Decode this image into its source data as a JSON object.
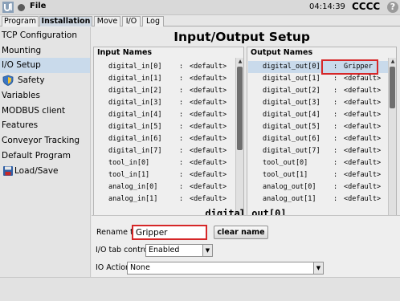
{
  "topbar": {
    "file": "File",
    "clock": "04:14:39",
    "robot": "CCCC",
    "help": "?"
  },
  "tabs": [
    {
      "label": "Program"
    },
    {
      "label": "Installation"
    },
    {
      "label": "Move"
    },
    {
      "label": "I/O"
    },
    {
      "label": "Log"
    }
  ],
  "sidebar": {
    "items": [
      {
        "label": "TCP Configuration"
      },
      {
        "label": "Mounting"
      },
      {
        "label": "I/O Setup"
      },
      {
        "label": "Safety"
      },
      {
        "label": "Variables"
      },
      {
        "label": "MODBUS client"
      },
      {
        "label": "Features"
      },
      {
        "label": "Conveyor Tracking"
      },
      {
        "label": "Default Program"
      },
      {
        "label": "Load/Save"
      }
    ]
  },
  "page": {
    "title": "Input/Output Setup"
  },
  "inputs": {
    "header": "Input Names",
    "rows": [
      {
        "name": "digital_in[0]",
        "sep": ":",
        "value": "<default>"
      },
      {
        "name": "digital_in[1]",
        "sep": ":",
        "value": "<default>"
      },
      {
        "name": "digital_in[2]",
        "sep": ":",
        "value": "<default>"
      },
      {
        "name": "digital_in[3]",
        "sep": ":",
        "value": "<default>"
      },
      {
        "name": "digital_in[4]",
        "sep": ":",
        "value": "<default>"
      },
      {
        "name": "digital_in[5]",
        "sep": ":",
        "value": "<default>"
      },
      {
        "name": "digital_in[6]",
        "sep": ":",
        "value": "<default>"
      },
      {
        "name": "digital_in[7]",
        "sep": ":",
        "value": "<default>"
      },
      {
        "name": "tool_in[0]",
        "sep": ":",
        "value": "<default>"
      },
      {
        "name": "tool_in[1]",
        "sep": ":",
        "value": "<default>"
      },
      {
        "name": "analog_in[0]",
        "sep": ":",
        "value": "<default>"
      },
      {
        "name": "analog_in[1]",
        "sep": ":",
        "value": "<default>"
      }
    ]
  },
  "outputs": {
    "header": "Output Names",
    "rows": [
      {
        "name": "digital_out[0]",
        "sep": ":",
        "value": "Gripper"
      },
      {
        "name": "digital_out[1]",
        "sep": ":",
        "value": "<default>"
      },
      {
        "name": "digital_out[2]",
        "sep": ":",
        "value": "<default>"
      },
      {
        "name": "digital_out[3]",
        "sep": ":",
        "value": "<default>"
      },
      {
        "name": "digital_out[4]",
        "sep": ":",
        "value": "<default>"
      },
      {
        "name": "digital_out[5]",
        "sep": ":",
        "value": "<default>"
      },
      {
        "name": "digital_out[6]",
        "sep": ":",
        "value": "<default>"
      },
      {
        "name": "digital_out[7]",
        "sep": ":",
        "value": "<default>"
      },
      {
        "name": "tool_out[0]",
        "sep": ":",
        "value": "<default>"
      },
      {
        "name": "tool_out[1]",
        "sep": ":",
        "value": "<default>"
      },
      {
        "name": "analog_out[0]",
        "sep": ":",
        "value": "<default>"
      },
      {
        "name": "analog_out[1]",
        "sep": ":",
        "value": "<default>"
      }
    ]
  },
  "selected": {
    "title": "digital_out[0]"
  },
  "edit": {
    "rename_label": "Rename to:",
    "rename_value": "Gripper",
    "clear_label": "clear name",
    "tab_control_label": "I/O tab control:",
    "tab_control_value": "Enabled",
    "action_label": "IO Action:",
    "action_value": "None"
  },
  "colors": {
    "selection": "#c9daeb",
    "highlight": "#d62728",
    "active_tab": "#cfd8e2"
  }
}
